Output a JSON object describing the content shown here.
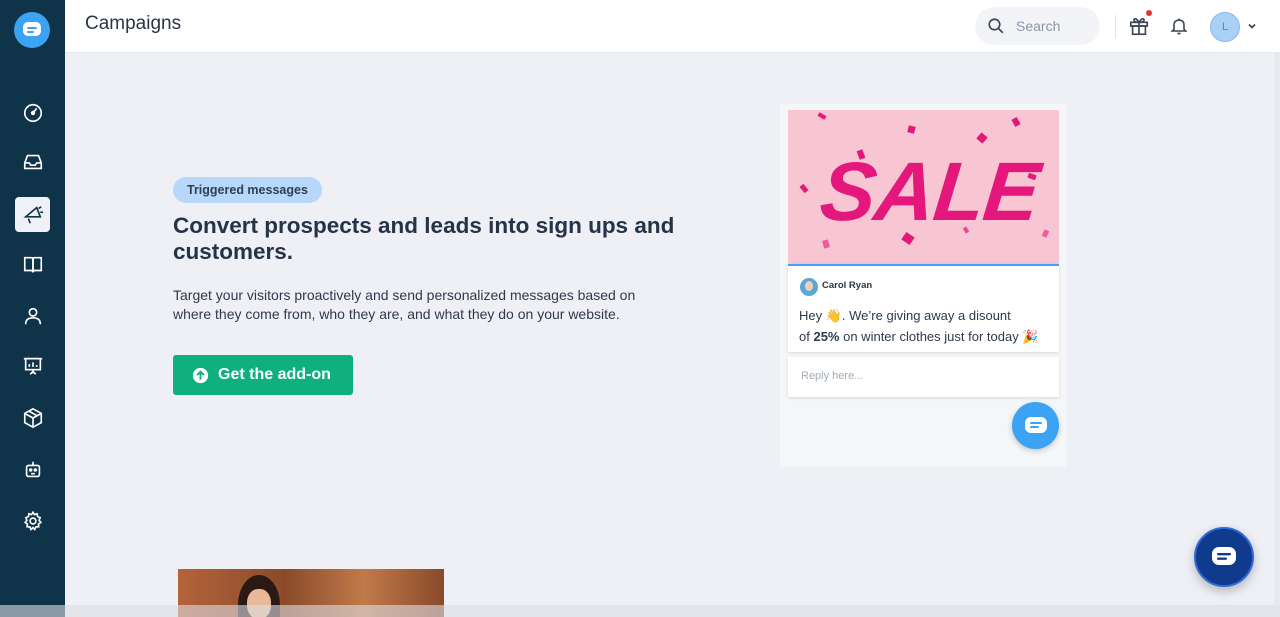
{
  "header": {
    "title": "Campaigns",
    "search_placeholder": "Search",
    "avatar_initial": "L"
  },
  "sidebar": {
    "items": [
      {
        "name": "dashboard",
        "icon": "gauge-icon"
      },
      {
        "name": "inbox",
        "icon": "inbox-icon"
      },
      {
        "name": "campaigns",
        "icon": "megaphone-icon",
        "active": true
      },
      {
        "name": "knowledge-base",
        "icon": "book-icon"
      },
      {
        "name": "contacts",
        "icon": "person-icon"
      },
      {
        "name": "reports",
        "icon": "presentation-chart-icon"
      },
      {
        "name": "add-ons",
        "icon": "cube-icon"
      },
      {
        "name": "bots",
        "icon": "robot-icon"
      },
      {
        "name": "settings",
        "icon": "gear-icon"
      }
    ]
  },
  "hero": {
    "badge": "Triggered messages",
    "headline": "Convert prospects and leads into sign ups and customers.",
    "description": "Target your visitors proactively and send personalized messages based on where they come from, who they are, and what they do on your website.",
    "cta_label": "Get the add-on"
  },
  "preview": {
    "banner_text": "SALE",
    "sender_name": "Carol Ryan",
    "message_line1": "Hey 👋. We’re giving away a disount",
    "message_line2_pre": "of ",
    "message_line2_bold": "25%",
    "message_line2_post": " on winter clothes just for today 🎉",
    "reply_placeholder": "Reply here..."
  },
  "colors": {
    "sidebar_bg": "#0f3348",
    "accent_blue": "#3ba2f4",
    "cta_green": "#0fb07d",
    "badge_bg": "#b8d8fb",
    "sale_pink": "#e3177c"
  }
}
